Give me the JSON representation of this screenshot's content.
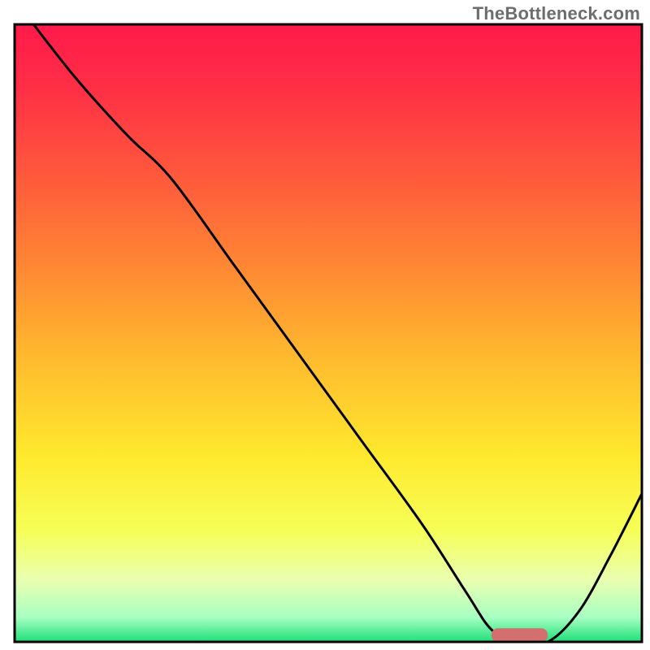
{
  "watermark": "TheBottleneck.com",
  "chart_data": {
    "type": "line",
    "title": "",
    "xlabel": "",
    "ylabel": "",
    "xlim": [
      0,
      100
    ],
    "ylim": [
      0,
      100
    ],
    "grid": false,
    "legend": false,
    "series": [
      {
        "name": "curve",
        "x": [
          3,
          10,
          18,
          25,
          35,
          45,
          55,
          65,
          72,
          76,
          80,
          85,
          90,
          95,
          100
        ],
        "y": [
          100,
          91,
          82,
          75,
          61,
          47,
          33,
          19,
          8,
          2,
          0,
          0,
          5,
          14,
          24
        ]
      }
    ],
    "gradient_stops": [
      {
        "offset": 0.0,
        "color": "#ff1a4b"
      },
      {
        "offset": 0.1,
        "color": "#ff2e46"
      },
      {
        "offset": 0.25,
        "color": "#ff5a3c"
      },
      {
        "offset": 0.4,
        "color": "#ff8a33"
      },
      {
        "offset": 0.55,
        "color": "#ffbd2e"
      },
      {
        "offset": 0.7,
        "color": "#ffe92e"
      },
      {
        "offset": 0.82,
        "color": "#f6ff57"
      },
      {
        "offset": 0.9,
        "color": "#e9ffb0"
      },
      {
        "offset": 0.96,
        "color": "#a8ffc2"
      },
      {
        "offset": 1.0,
        "color": "#1ee07a"
      }
    ],
    "marker": {
      "name": "bottleneck-marker",
      "fill": "#d36f6f",
      "x_start": 76,
      "x_end": 85,
      "y": 0,
      "rx": 8,
      "height_pct": 2.2
    },
    "frame": {
      "stroke": "#000000",
      "stroke_width": 3
    },
    "line_style": {
      "stroke": "#000000",
      "stroke_width": 3
    }
  }
}
